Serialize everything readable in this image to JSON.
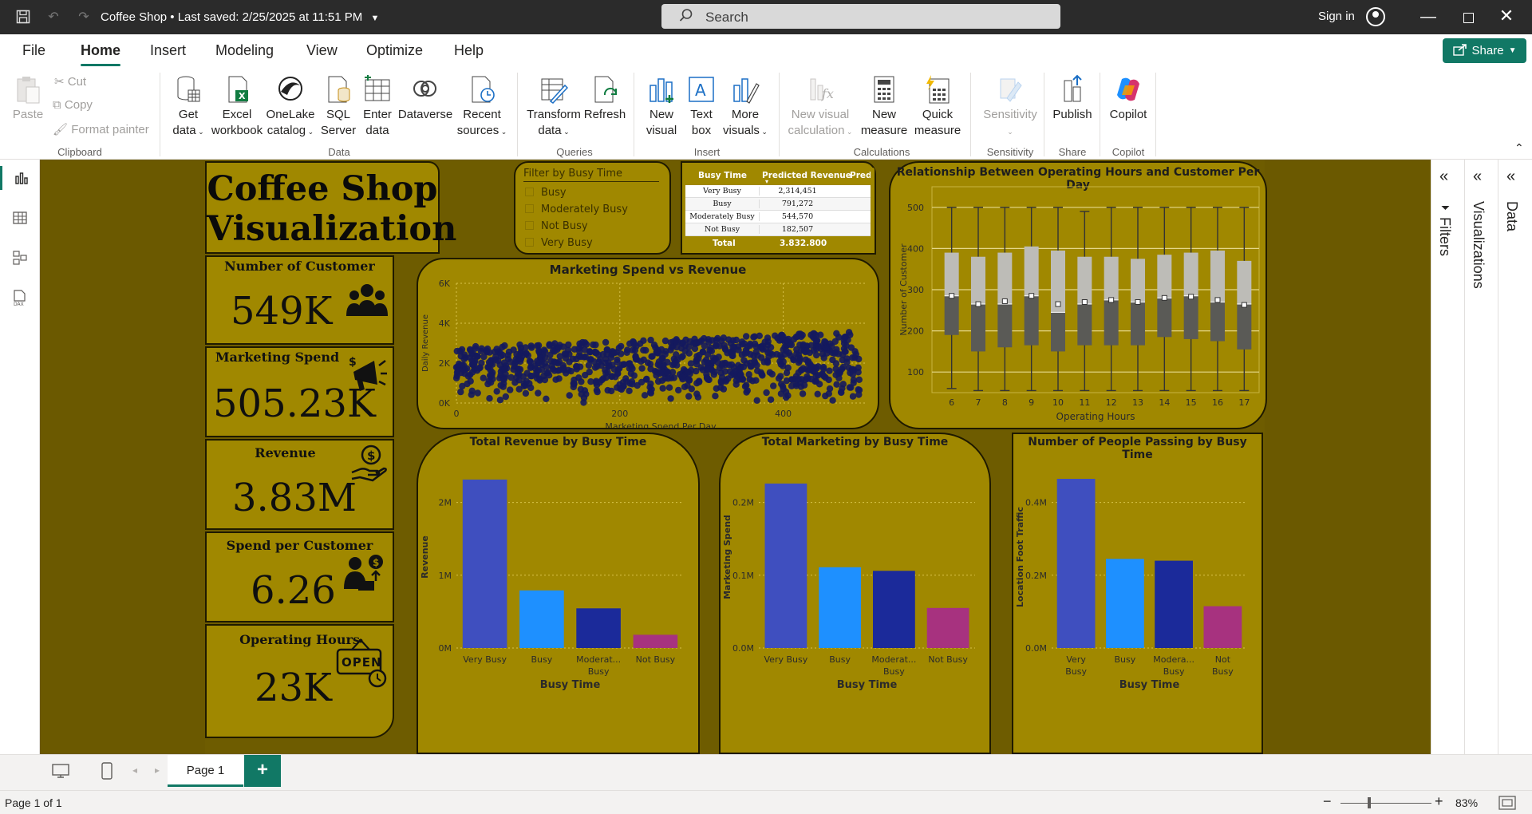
{
  "titlebar": {
    "doc_title": "Coffee Shop",
    "save_status": "• Last saved: 2/25/2025 at 11:51 PM",
    "search_placeholder": "Search",
    "signin": "Sign in"
  },
  "ribbon_tabs": [
    "File",
    "Home",
    "Insert",
    "Modeling",
    "View",
    "Optimize",
    "Help"
  ],
  "share_label": "Share",
  "ribbon": {
    "clipboard": {
      "paste": "Paste",
      "cut": "Cut",
      "copy": "Copy",
      "format_painter": "Format painter",
      "label": "Clipboard"
    },
    "data": {
      "get_data": [
        "Get",
        "data"
      ],
      "excel": [
        "Excel",
        "workbook"
      ],
      "onelake": [
        "OneLake",
        "catalog"
      ],
      "sql": [
        "SQL",
        "Server"
      ],
      "enter": [
        "Enter",
        "data"
      ],
      "dataverse": "Dataverse",
      "recent": [
        "Recent",
        "sources"
      ],
      "label": "Data"
    },
    "queries": {
      "transform": [
        "Transform",
        "data"
      ],
      "refresh": "Refresh",
      "label": "Queries"
    },
    "insert": {
      "new_visual": [
        "New",
        "visual"
      ],
      "text_box": [
        "Text",
        "box"
      ],
      "more_visuals": [
        "More",
        "visuals"
      ],
      "label": "Insert"
    },
    "calculations": {
      "new_visual_calc": [
        "New visual",
        "calculation"
      ],
      "new_measure": [
        "New",
        "measure"
      ],
      "quick_measure": [
        "Quick",
        "measure"
      ],
      "label": "Calculations"
    },
    "sensitivity": {
      "btn": "Sensitivity",
      "label": "Sensitivity"
    },
    "share": {
      "publish": "Publish",
      "label": "Share"
    },
    "copilot": {
      "btn": "Copilot",
      "label": "Copilot"
    }
  },
  "report": {
    "title_line1": "Coffee Shop",
    "title_line2": "Visualization",
    "kpis": [
      {
        "label": "Number of Customer",
        "value": "549K",
        "icon": "people-icon"
      },
      {
        "label": "Marketing Spend",
        "value": "505.23K",
        "icon": "megaphone-icon"
      },
      {
        "label": "Revenue",
        "value": "3.83M",
        "icon": "money-hand-icon"
      },
      {
        "label": "Spend per Customer",
        "value": "6.26",
        "icon": "person-dollar-icon"
      },
      {
        "label": "Operating Hours",
        "value": "23K",
        "icon": "open-sign-icon"
      }
    ],
    "slicer": {
      "title": "Filter by Busy Time",
      "options": [
        "Busy",
        "Moderately Busy",
        "Not Busy",
        "Very Busy"
      ]
    },
    "table": {
      "headers": [
        "Busy Time",
        "Predicted Revenue",
        "Predi"
      ],
      "rows": [
        [
          "Very Busy",
          "2,314,451"
        ],
        [
          "Busy",
          "791,272"
        ],
        [
          "Moderately Busy",
          "544,570"
        ],
        [
          "Not Busy",
          "182,507"
        ]
      ],
      "total_label": "Total",
      "total_value": "3,832,800"
    }
  },
  "chart_data": [
    {
      "type": "scatter",
      "title": "Marketing Spend vs Revenue",
      "xlabel": "Marketing Spend Per Day",
      "ylabel": "Daily Revenue",
      "xlim": [
        0,
        500
      ],
      "ylim": [
        0,
        6000
      ],
      "x_ticks": [
        "0",
        "200",
        "400"
      ],
      "y_ticks": [
        "0K",
        "2K",
        "4K",
        "6K"
      ],
      "color": "#141a5e",
      "point_count": 2000,
      "revenue_range_low": [
        0,
        1500
      ],
      "revenue_range_high": [
        3000,
        5000
      ]
    },
    {
      "type": "box",
      "title": "Relationship Between Operating Hours and Customer Per Day",
      "xlabel": "Operating Hours",
      "ylabel": "Number of Customer",
      "ylim": [
        50,
        550
      ],
      "y_ticks": [
        "100",
        "200",
        "300",
        "400",
        "500"
      ],
      "categories": [
        "6",
        "7",
        "8",
        "9",
        "10",
        "11",
        "12",
        "13",
        "14",
        "15",
        "16",
        "17"
      ],
      "min": [
        60,
        55,
        55,
        55,
        55,
        55,
        55,
        55,
        55,
        55,
        55,
        55
      ],
      "q1": [
        190,
        150,
        160,
        165,
        150,
        165,
        165,
        165,
        185,
        180,
        175,
        155
      ],
      "median": [
        285,
        265,
        265,
        285,
        245,
        265,
        275,
        270,
        280,
        285,
        270,
        265
      ],
      "q3": [
        390,
        380,
        390,
        405,
        395,
        380,
        380,
        375,
        385,
        390,
        395,
        370
      ],
      "max": [
        500,
        500,
        500,
        500,
        500,
        490,
        500,
        500,
        500,
        500,
        500,
        500
      ],
      "mean": [
        285,
        265,
        272,
        285,
        265,
        270,
        275,
        270,
        280,
        283,
        275,
        263
      ]
    },
    {
      "type": "bar",
      "title": "Total Revenue by Busy Time",
      "xlabel": "Busy Time",
      "ylabel": "Revenue",
      "categories": [
        "Very Busy",
        "Busy",
        "Moderat...",
        "Not Busy"
      ],
      "category_lines": [
        [
          "Very Busy"
        ],
        [
          "Busy"
        ],
        [
          "Moderat...",
          "Busy"
        ],
        [
          "Not Busy"
        ]
      ],
      "values": [
        2314451,
        791272,
        544570,
        182507
      ],
      "ylim": [
        0,
        2500000
      ],
      "y_ticks": [
        [
          "2M",
          2000000
        ],
        [
          "1M",
          1000000
        ],
        [
          "0M",
          0
        ]
      ],
      "colors": [
        "#3f4fbf",
        "#1e90ff",
        "#1b2a9a",
        "#a7327f"
      ]
    },
    {
      "type": "bar",
      "title": "Total Marketing by Busy Time",
      "xlabel": "Busy Time",
      "ylabel": "Marketing Spend",
      "categories": [
        "Very Busy",
        "Busy",
        "Moderat...",
        "Not Busy"
      ],
      "category_lines": [
        [
          "Very Busy"
        ],
        [
          "Busy"
        ],
        [
          "Moderat...",
          "Busy"
        ],
        [
          "Not Busy"
        ]
      ],
      "values": [
        226000,
        111000,
        106000,
        55000
      ],
      "ylim": [
        0,
        250000
      ],
      "y_ticks": [
        [
          "0.2M",
          200000
        ],
        [
          "0.1M",
          100000
        ],
        [
          "0.0M",
          0
        ]
      ],
      "colors": [
        "#3f4fbf",
        "#1e90ff",
        "#1b2a9a",
        "#a7327f"
      ]
    },
    {
      "type": "bar",
      "title": "Number of People Passing by Busy Time",
      "xlabel": "Busy Time",
      "ylabel": "Location Foot Traffic",
      "categories": [
        "Very Busy",
        "Busy",
        "Modera... Busy",
        "Not Busy"
      ],
      "category_lines": [
        [
          "Very",
          "Busy"
        ],
        [
          "Busy"
        ],
        [
          "Modera...",
          "Busy"
        ],
        [
          "Not",
          "Busy"
        ]
      ],
      "values": [
        465000,
        245000,
        240000,
        115000
      ],
      "ylim": [
        0,
        500000
      ],
      "y_ticks": [
        [
          "0.4M",
          400000
        ],
        [
          "0.2M",
          200000
        ],
        [
          "0.0M",
          0
        ]
      ],
      "colors": [
        "#3f4fbf",
        "#1e90ff",
        "#1b2a9a",
        "#a7327f"
      ]
    }
  ],
  "right_panes": {
    "filters": "Filters",
    "visualizations": "Visualizations",
    "data": "Data"
  },
  "pages": {
    "tab": "Page 1"
  },
  "status": {
    "page_of": "Page 1 of 1",
    "zoom": "83%"
  }
}
